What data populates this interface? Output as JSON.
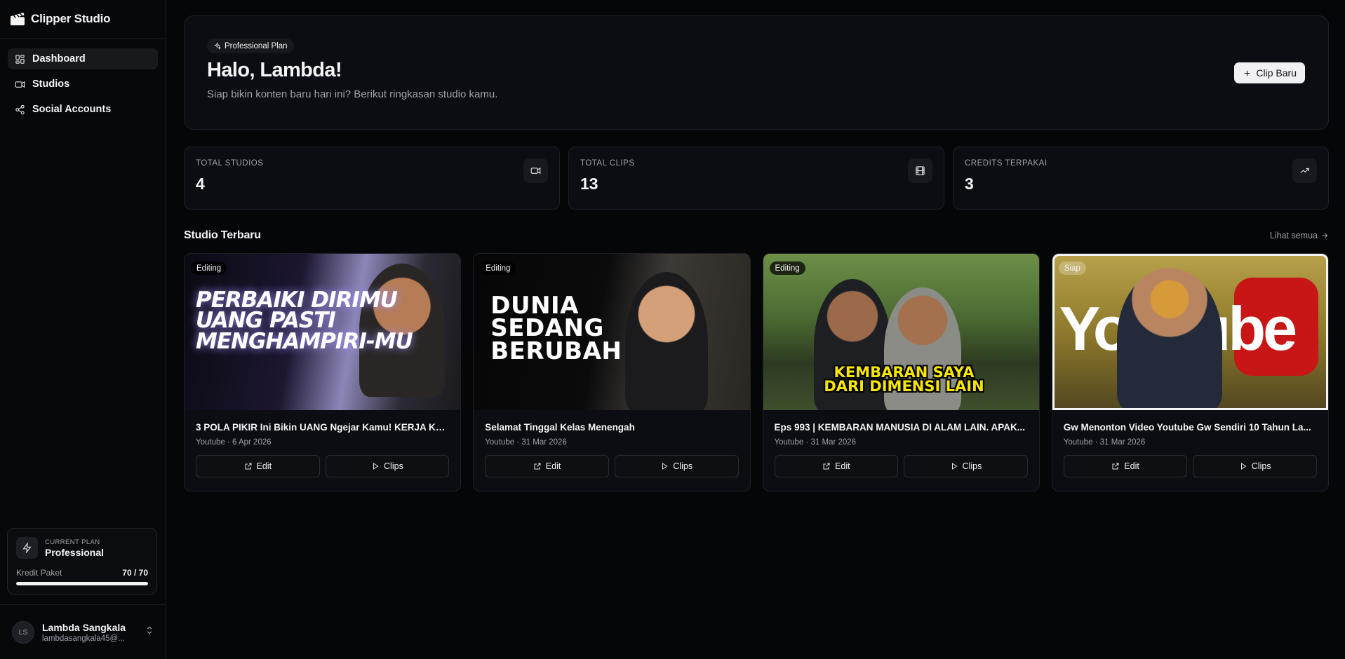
{
  "app": {
    "name": "Clipper Studio"
  },
  "nav": [
    {
      "label": "Dashboard",
      "icon": "grid-icon",
      "active": true
    },
    {
      "label": "Studios",
      "icon": "video-icon",
      "active": false
    },
    {
      "label": "Social Accounts",
      "icon": "share-icon",
      "active": false
    }
  ],
  "plan": {
    "label": "CURRENT PLAN",
    "name": "Professional",
    "credit_label": "Kredit Paket",
    "credit_value": "70 / 70",
    "credit_fraction": 1.0
  },
  "user": {
    "initials": "LS",
    "name": "Lambda Sangkala",
    "email": "lambdasangkala45@..."
  },
  "hero": {
    "badge": "Professional Plan",
    "title": "Halo, Lambda!",
    "subtitle": "Siap bikin konten baru hari ini? Berikut ringkasan studio kamu.",
    "new_button": "Clip Baru"
  },
  "stats": [
    {
      "label": "TOTAL STUDIOS",
      "value": "4",
      "icon": "video-icon"
    },
    {
      "label": "TOTAL CLIPS",
      "value": "13",
      "icon": "film-icon"
    },
    {
      "label": "CREDITS TERPAKAI",
      "value": "3",
      "icon": "trending-up-icon"
    }
  ],
  "recent": {
    "title": "Studio Terbaru",
    "see_all": "Lihat semua",
    "cards": [
      {
        "status": "Editing",
        "title": "3 POLA PIKIR Ini Bikin UANG Ngejar Kamu! KERJA KE...",
        "meta": "Youtube · 6 Apr 2026",
        "thumb_text": "PERBAIKI DIRIMU UANG PASTI MENGHAMPIRI-MU",
        "edit": "Edit",
        "clips": "Clips"
      },
      {
        "status": "Editing",
        "title": "Selamat Tinggal Kelas Menengah",
        "meta": "Youtube · 31 Mar 2026",
        "thumb_text": "DUNIA SEDANG BERUBAH",
        "edit": "Edit",
        "clips": "Clips"
      },
      {
        "status": "Editing",
        "title": "Eps 993 | KEMBARAN MANUSIA DI ALAM LAIN. APAK...",
        "meta": "Youtube · 31 Mar 2026",
        "thumb_text": "KEMBARAN SAYA DARI DIMENSI LAIN",
        "edit": "Edit",
        "clips": "Clips"
      },
      {
        "status": "Siap",
        "title": "Gw Menonton Video Youtube Gw Sendiri 10 Tahun La...",
        "meta": "Youtube · 31 Mar 2026",
        "thumb_text": "YouTube",
        "edit": "Edit",
        "clips": "Clips"
      }
    ]
  }
}
